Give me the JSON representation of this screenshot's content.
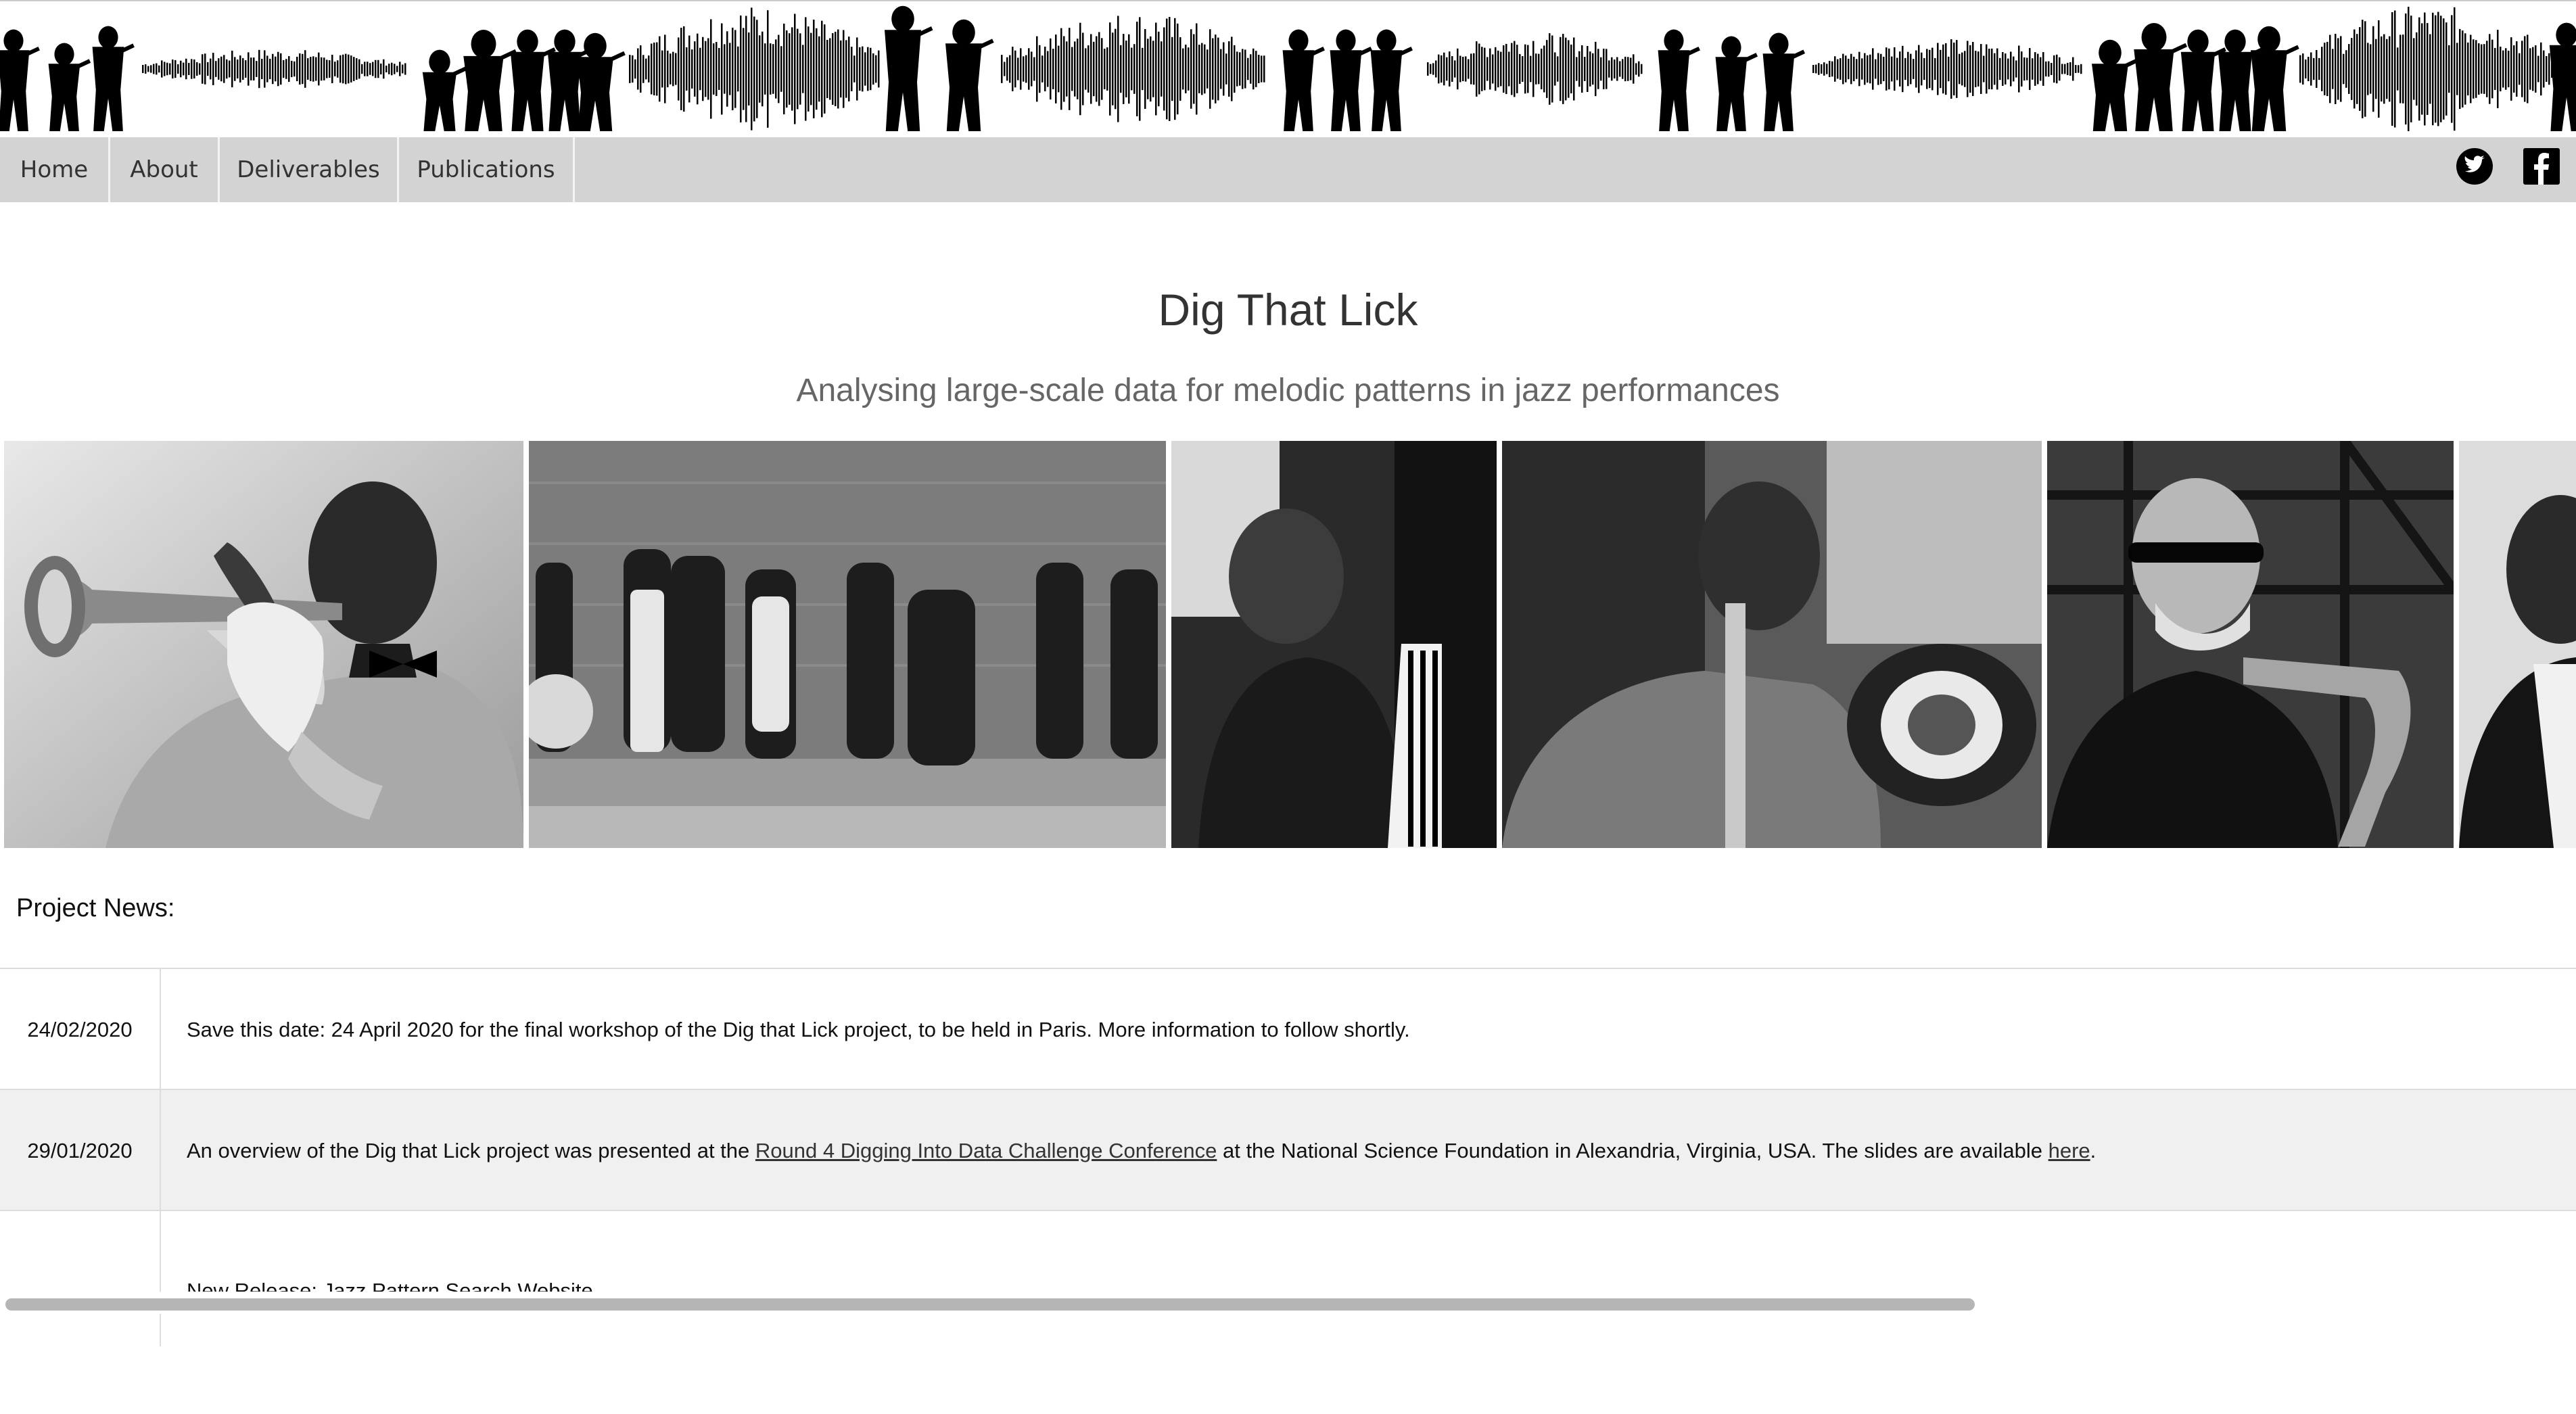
{
  "nav": {
    "items": [
      {
        "label": "Home"
      },
      {
        "label": "About"
      },
      {
        "label": "Deliverables"
      },
      {
        "label": "Publications"
      }
    ],
    "social": {
      "twitter_icon": "twitter-icon",
      "facebook_icon": "facebook-icon"
    }
  },
  "hero": {
    "title": "Dig That Lick",
    "subtitle": "Analysing large-scale data for melodic patterns in jazz performances"
  },
  "news": {
    "heading": "Project News:",
    "items": [
      {
        "date": "24/02/2020",
        "text": "Save this date: 24 April 2020 for the final workshop of the Dig that Lick project, to be held in Paris. More information to follow shortly."
      },
      {
        "date": "29/01/2020",
        "text_before": "An overview of the Dig that Lick project was presented at the ",
        "link1": "Round 4 Digging Into Data Challenge Conference",
        "text_middle": " at the National Science Foundation in Alexandria, Virginia, USA. The slides are available ",
        "link2": "here",
        "text_after": "."
      },
      {
        "date": "",
        "text": "New Release: Jazz Pattern Search Website"
      }
    ]
  },
  "colors": {
    "nav_bg": "#d3d3d3",
    "row_alt_bg": "#f0f0f0",
    "title": "#333333",
    "subtitle": "#666666"
  }
}
